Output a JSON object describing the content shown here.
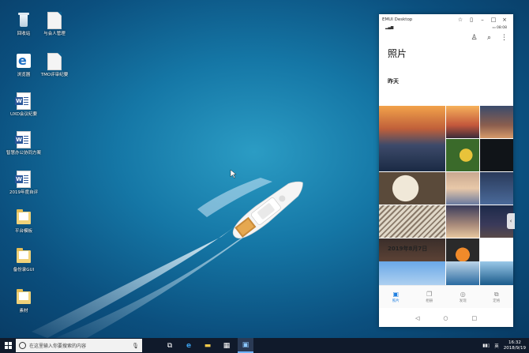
{
  "desktop": {
    "icons": [
      {
        "label": "回收站",
        "kind": "bin"
      },
      {
        "label": "与会人管理",
        "kind": "doc"
      },
      {
        "label": "浏览器",
        "kind": "edge"
      },
      {
        "label": "TMO评审纪要",
        "kind": "doc"
      },
      {
        "label": "UXD会议纪要",
        "kind": "word"
      },
      {
        "label": "智慧办公协同方案",
        "kind": "word"
      },
      {
        "label": "2019年度自评",
        "kind": "word"
      },
      {
        "label": "平台模板",
        "kind": "folder"
      },
      {
        "label": "备份录GUI",
        "kind": "folder"
      },
      {
        "label": "素材",
        "kind": "folder"
      }
    ]
  },
  "phone_window": {
    "window_title": "EMUI Desktop",
    "status_time": "08:08",
    "page_title": "照片",
    "section_yesterday": "昨天",
    "section_date": "2019年8月7日",
    "tabs": [
      {
        "label": "照片",
        "icon": "photo-icon",
        "active": true
      },
      {
        "label": "相册",
        "icon": "album-icon",
        "active": false
      },
      {
        "label": "发现",
        "icon": "discover-icon",
        "active": false
      },
      {
        "label": "定格",
        "icon": "moments-icon",
        "active": false
      }
    ]
  },
  "taskbar": {
    "search_placeholder": "在这里输入你要搜索的内容",
    "time": "16:32",
    "date": "2018/9/19",
    "ime": "英"
  },
  "colors": {
    "accent": "#1e7fe0",
    "taskbar": "#101a2b"
  }
}
